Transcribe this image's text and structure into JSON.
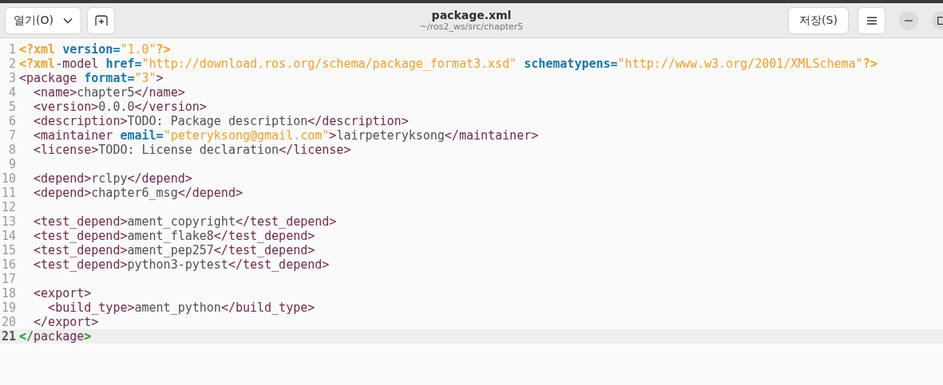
{
  "header": {
    "open_button": {
      "label": "열기(O)"
    },
    "title": "package.xml",
    "subtitle": "~/ros2_ws/src/chapter5",
    "save_button": {
      "label": "저장(S)"
    }
  },
  "editor": {
    "lines": [
      {
        "number": "1",
        "current": false,
        "tokens": [
          {
            "kind": "pi",
            "text": "<?xml"
          },
          {
            "kind": "attr",
            "text": " version="
          },
          {
            "kind": "string",
            "text": "\"1.0\""
          },
          {
            "kind": "pi",
            "text": "?>"
          }
        ]
      },
      {
        "number": "2",
        "current": false,
        "tokens": [
          {
            "kind": "pi",
            "text": "<?xml"
          },
          {
            "kind": "tag",
            "text": "-model "
          },
          {
            "kind": "attr",
            "text": "href="
          },
          {
            "kind": "string",
            "text": "\"http://download.ros.org/schema/package_format3.xsd\""
          },
          {
            "kind": "attr",
            "text": " schematypens="
          },
          {
            "kind": "string",
            "text": "\"http://www.w3.org/2001/XMLSchema\""
          },
          {
            "kind": "pi",
            "text": "?>"
          }
        ]
      },
      {
        "number": "3",
        "current": false,
        "tokens": [
          {
            "kind": "tag",
            "text": "<package "
          },
          {
            "kind": "attr",
            "text": "format="
          },
          {
            "kind": "string",
            "text": "\"3\""
          },
          {
            "kind": "tag",
            "text": ">"
          }
        ]
      },
      {
        "number": "4",
        "current": false,
        "tokens": [
          {
            "kind": "tag",
            "text": "  <name>"
          },
          {
            "kind": "text",
            "text": "chapter5"
          },
          {
            "kind": "tag",
            "text": "</name>"
          }
        ]
      },
      {
        "number": "5",
        "current": false,
        "tokens": [
          {
            "kind": "tag",
            "text": "  <version>"
          },
          {
            "kind": "text",
            "text": "0.0.0"
          },
          {
            "kind": "tag",
            "text": "</version>"
          }
        ]
      },
      {
        "number": "6",
        "current": false,
        "tokens": [
          {
            "kind": "tag",
            "text": "  <description>"
          },
          {
            "kind": "text",
            "text": "TODO: Package description"
          },
          {
            "kind": "tag",
            "text": "</description>"
          }
        ]
      },
      {
        "number": "7",
        "current": false,
        "tokens": [
          {
            "kind": "tag",
            "text": "  <maintainer "
          },
          {
            "kind": "attr",
            "text": "email="
          },
          {
            "kind": "string",
            "text": "\"peteryksong@gmail.com\""
          },
          {
            "kind": "tag",
            "text": ">"
          },
          {
            "kind": "text",
            "text": "lairpeteryksong"
          },
          {
            "kind": "tag",
            "text": "</maintainer>"
          }
        ]
      },
      {
        "number": "8",
        "current": false,
        "tokens": [
          {
            "kind": "tag",
            "text": "  <license>"
          },
          {
            "kind": "text",
            "text": "TODO: License declaration"
          },
          {
            "kind": "tag",
            "text": "</license>"
          }
        ]
      },
      {
        "number": "9",
        "current": false
      },
      {
        "number": "10",
        "current": false,
        "tokens": [
          {
            "kind": "tag",
            "text": "  <depend>"
          },
          {
            "kind": "text",
            "text": "rclpy"
          },
          {
            "kind": "tag",
            "text": "</depend>"
          }
        ]
      },
      {
        "number": "11",
        "current": false,
        "tokens": [
          {
            "kind": "tag",
            "text": "  <depend>"
          },
          {
            "kind": "text",
            "text": "chapter6_msg"
          },
          {
            "kind": "tag",
            "text": "</depend>"
          }
        ]
      },
      {
        "number": "12",
        "current": false
      },
      {
        "number": "13",
        "current": false,
        "tokens": [
          {
            "kind": "tag",
            "text": "  <test_depend>"
          },
          {
            "kind": "text",
            "text": "ament_copyright"
          },
          {
            "kind": "tag",
            "text": "</test_depend>"
          }
        ]
      },
      {
        "number": "14",
        "current": false,
        "tokens": [
          {
            "kind": "tag",
            "text": "  <test_depend>"
          },
          {
            "kind": "text",
            "text": "ament_flake8"
          },
          {
            "kind": "tag",
            "text": "</test_depend>"
          }
        ]
      },
      {
        "number": "15",
        "current": false,
        "tokens": [
          {
            "kind": "tag",
            "text": "  <test_depend>"
          },
          {
            "kind": "text",
            "text": "ament_pep257"
          },
          {
            "kind": "tag",
            "text": "</test_depend>"
          }
        ]
      },
      {
        "number": "16",
        "current": false,
        "tokens": [
          {
            "kind": "tag",
            "text": "  <test_depend>"
          },
          {
            "kind": "text",
            "text": "python3-pytest"
          },
          {
            "kind": "tag",
            "text": "</test_depend>"
          }
        ]
      },
      {
        "number": "17",
        "current": false
      },
      {
        "number": "18",
        "current": false,
        "tokens": [
          {
            "kind": "tag",
            "text": "  <export>"
          }
        ]
      },
      {
        "number": "19",
        "current": false,
        "tokens": [
          {
            "kind": "tag",
            "text": "    <build_type>"
          },
          {
            "kind": "text",
            "text": "ament_python"
          },
          {
            "kind": "tag",
            "text": "</build_type>"
          }
        ]
      },
      {
        "number": "20",
        "current": false,
        "tokens": [
          {
            "kind": "tag",
            "text": "  </export>"
          }
        ]
      },
      {
        "number": "21",
        "current": true,
        "tokens": [
          {
            "kind": "match",
            "text": "</"
          },
          {
            "kind": "tag",
            "text": "package"
          },
          {
            "kind": "match",
            "text": ">"
          }
        ]
      }
    ]
  }
}
